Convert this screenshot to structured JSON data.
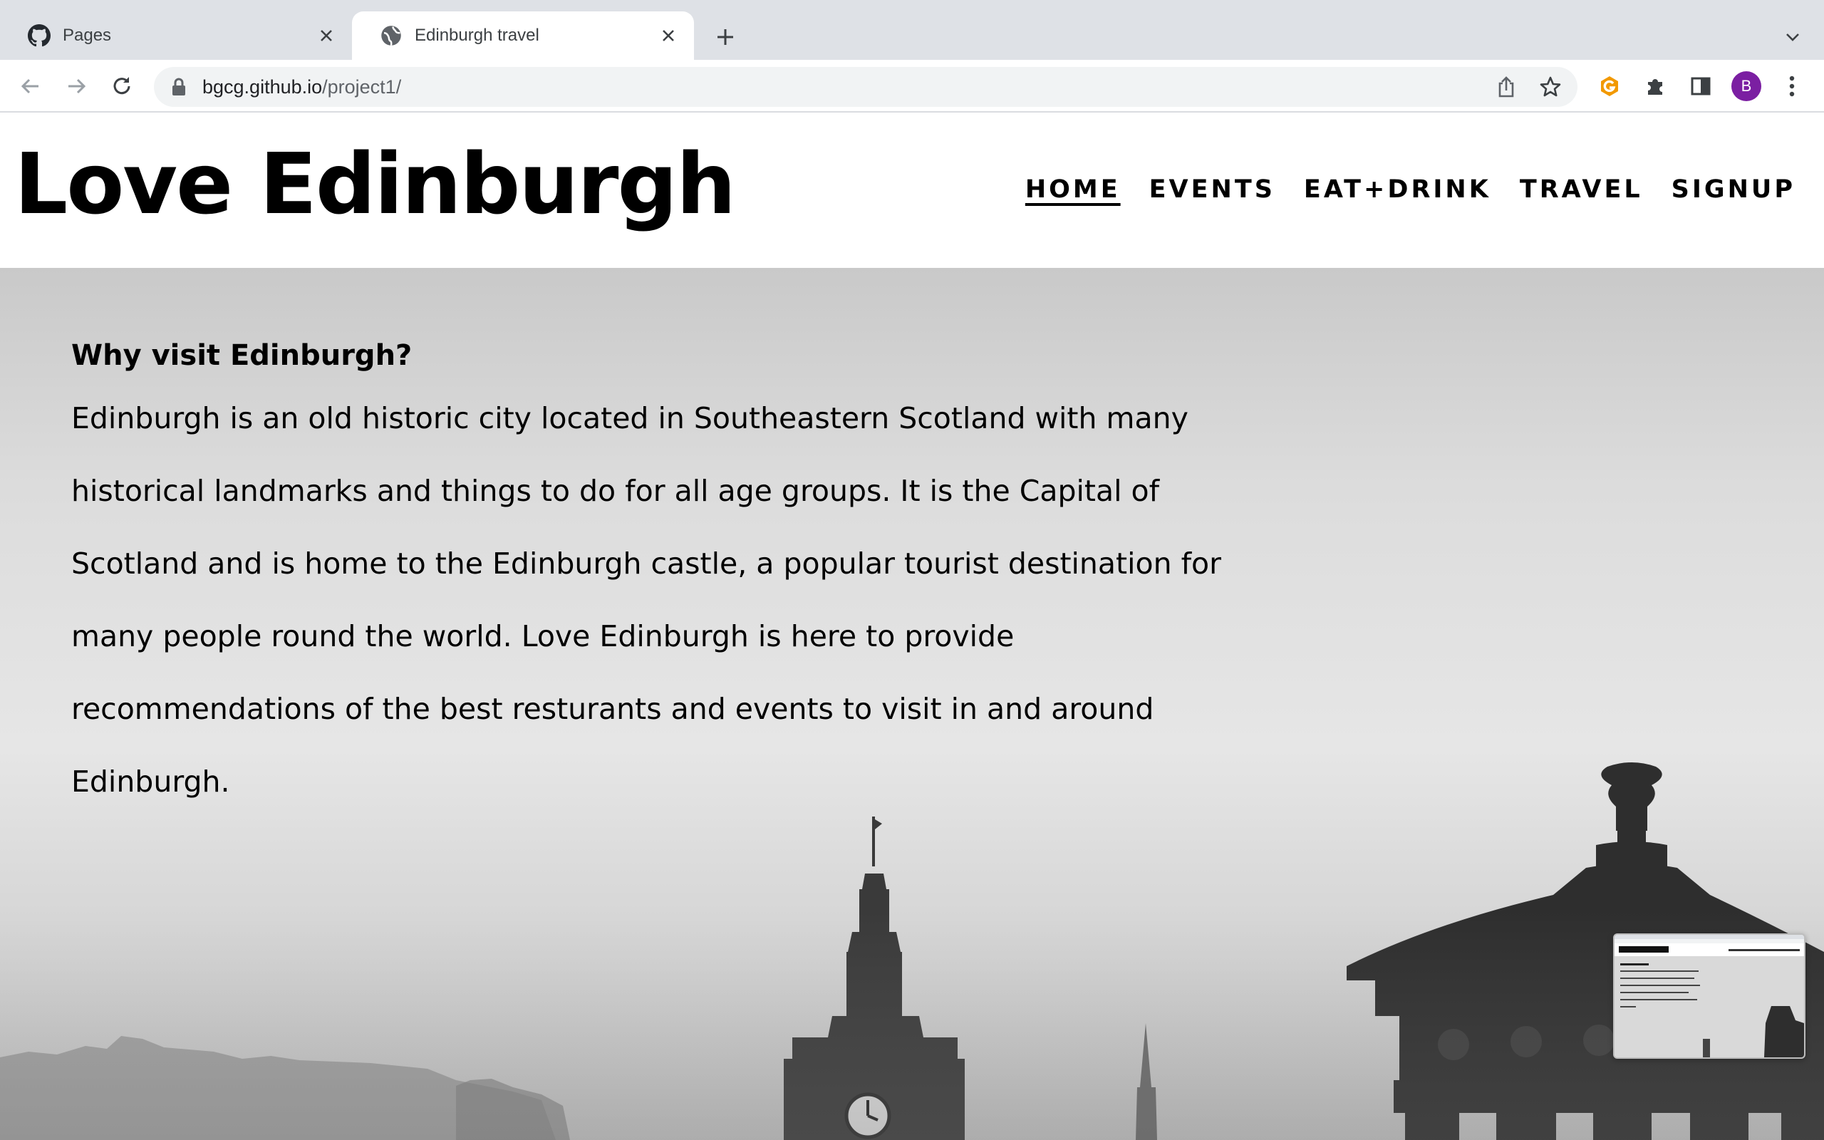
{
  "browser": {
    "tabs": [
      {
        "title": "Pages",
        "icon": "github-icon"
      },
      {
        "title": "Edinburgh travel",
        "icon": "globe-icon"
      }
    ],
    "url_host": "bgcg.github.io",
    "url_path": "/project1/",
    "profile_initial": "B"
  },
  "site": {
    "logo": "Love Edinburgh",
    "nav": [
      "HOME",
      "EVENTS",
      "EAT+DRINK",
      "TRAVEL",
      "SIGNUP"
    ],
    "active_nav": "HOME"
  },
  "intro": {
    "heading": "Why visit Edinburgh?",
    "body": "Edinburgh is an old historic city located in Southeastern Scotland with many historical landmarks and things to do for all age groups. It is the Capital of Scotland and is home to the Edinburgh castle, a popular tourist destination for many people round the world. Love Edinburgh is here to provide recommendations of the best resturants and events to visit in and around Edinburgh."
  },
  "colors": {
    "tabstrip": "#dee1e6",
    "avatar": "#7b1fa2",
    "extension_accent": "#f29900"
  }
}
